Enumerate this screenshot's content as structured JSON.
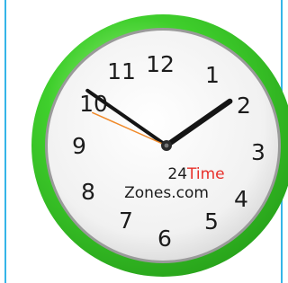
{
  "clock": {
    "numerals": [
      "12",
      "1",
      "2",
      "3",
      "4",
      "5",
      "6",
      "7",
      "8",
      "9",
      "10",
      "11"
    ],
    "brand_number": "24",
    "brand_word": "Time",
    "brand_domain": "Zones.com",
    "time": {
      "hour": 1,
      "minute": 50,
      "second": 49
    }
  },
  "colors": {
    "rim": "#3fcf2c",
    "face": "#f4f4f4",
    "hands": "#151515",
    "second_hand": "#f08a2a",
    "brand_accent": "#e8302a",
    "side_border": "#35b5e8"
  },
  "icons": {
    "clock": "analog-clock-icon"
  }
}
